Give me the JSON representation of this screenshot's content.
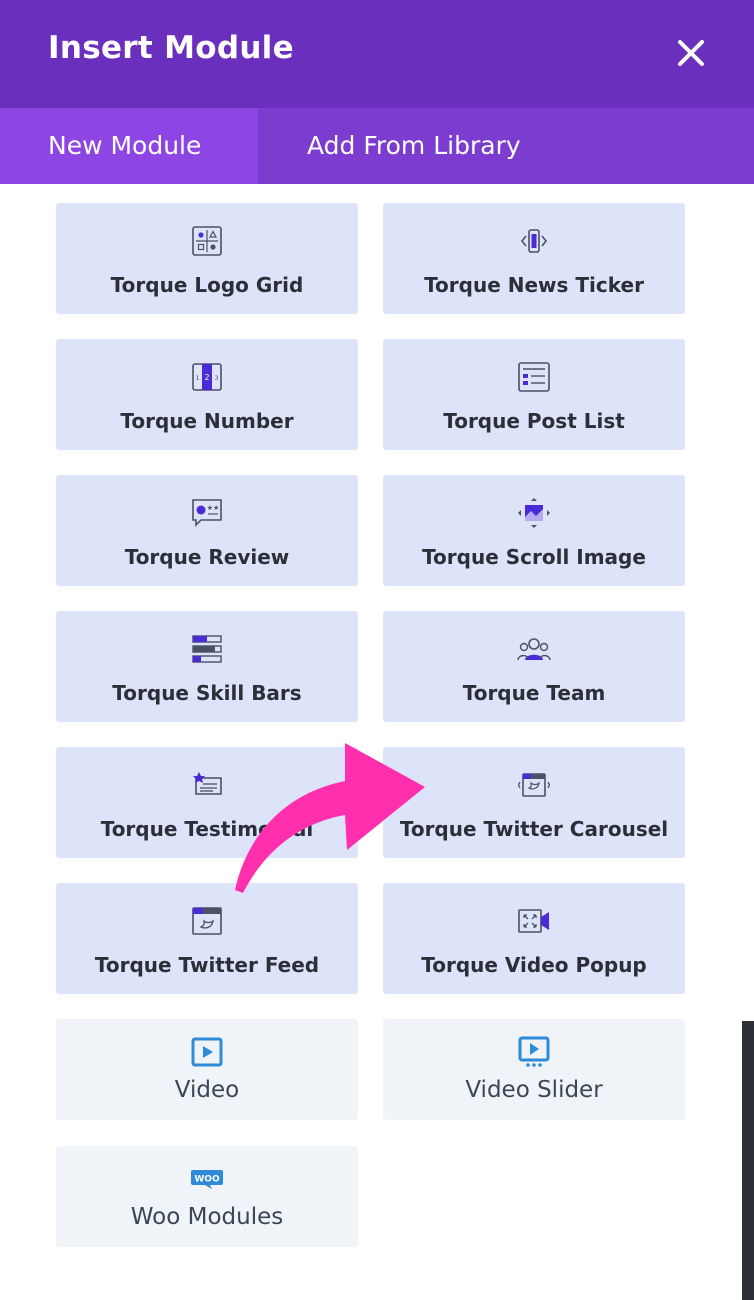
{
  "dialog": {
    "title": "Insert Module",
    "close_icon": "close-icon"
  },
  "tabs": [
    {
      "label": "New Module",
      "active": true
    },
    {
      "label": "Add From Library",
      "active": false
    }
  ],
  "modules": [
    {
      "label": "Torque Logo Grid",
      "icon": "logo-grid-icon"
    },
    {
      "label": "Torque News Ticker",
      "icon": "news-ticker-icon"
    },
    {
      "label": "Torque Number",
      "icon": "number-icon"
    },
    {
      "label": "Torque Post List",
      "icon": "post-list-icon"
    },
    {
      "label": "Torque Review",
      "icon": "review-icon"
    },
    {
      "label": "Torque Scroll Image",
      "icon": "scroll-image-icon"
    },
    {
      "label": "Torque Skill Bars",
      "icon": "skill-bars-icon"
    },
    {
      "label": "Torque Team",
      "icon": "team-icon"
    },
    {
      "label": "Torque Testimonial",
      "icon": "testimonial-icon"
    },
    {
      "label": "Torque Twitter Carousel",
      "icon": "twitter-carousel-icon"
    },
    {
      "label": "Torque Twitter Feed",
      "icon": "twitter-feed-icon"
    },
    {
      "label": "Torque Video Popup",
      "icon": "video-popup-icon"
    },
    {
      "label": "Video",
      "icon": "video-icon"
    },
    {
      "label": "Video Slider",
      "icon": "video-slider-icon"
    },
    {
      "label": "Woo Modules",
      "icon": "woo-icon",
      "badge": "WOO"
    }
  ],
  "colors": {
    "header": "#6b2fbd",
    "tab_bar": "#7c3ccf",
    "tab_active": "#8d45e3",
    "card_torque": "#dde3f9",
    "card_plain": "#f0f3f8",
    "accent_blue": "#2e8bd8",
    "annotation_arrow": "#ff2fae"
  }
}
